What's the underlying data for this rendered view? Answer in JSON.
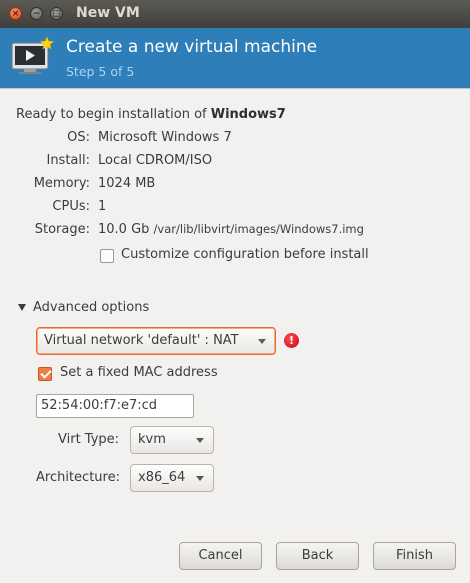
{
  "window": {
    "title": "New VM",
    "close_glyph": "×",
    "minimize_glyph": "−",
    "maximize_glyph": "□"
  },
  "header": {
    "title": "Create a new virtual machine",
    "step": "Step 5 of 5",
    "icon": "new-vm-monitor-icon",
    "background_color": "#2e7eb9"
  },
  "summary": {
    "ready_prefix": "Ready to begin installation of",
    "vm_name": "Windows7",
    "os_label": "OS:",
    "os_value": "Microsoft Windows 7",
    "install_label": "Install:",
    "install_value": "Local CDROM/ISO",
    "memory_label": "Memory:",
    "memory_value": "1024 MB",
    "cpus_label": "CPUs:",
    "cpus_value": "1",
    "storage_label": "Storage:",
    "storage_size": "10.0 Gb",
    "storage_path": "/var/lib/libvirt/images/Windows7.img",
    "customize_label": "Customize configuration before install",
    "customize_checked": false
  },
  "advanced": {
    "expander_label": "Advanced options",
    "expanded": true,
    "network_selected": "Virtual network 'default' : NAT",
    "network_error_glyph": "!",
    "fixed_mac_label": "Set a fixed MAC address",
    "fixed_mac_checked": true,
    "mac_value": "52:54:00:f7:e7:cd",
    "virt_type_label": "Virt Type:",
    "virt_type_value": "kvm",
    "arch_label": "Architecture:",
    "arch_value": "x86_64"
  },
  "buttons": {
    "cancel": "Cancel",
    "back": "Back",
    "finish": "Finish"
  },
  "colors": {
    "accent": "#ef7d45",
    "error": "#d8141f"
  }
}
